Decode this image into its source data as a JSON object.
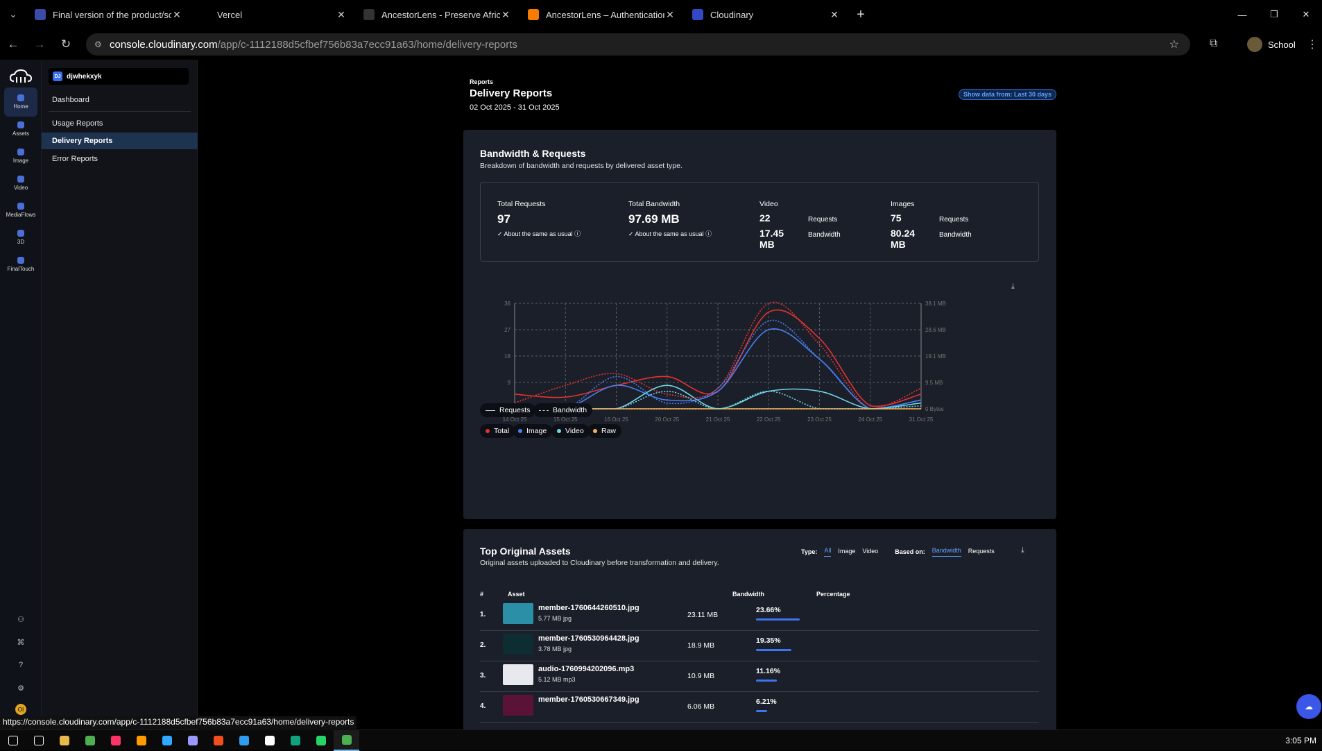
{
  "browser": {
    "tabs": [
      {
        "label": "Final version of the product/sol",
        "icon": "doc-icon",
        "color": "#3b4ba8"
      },
      {
        "label": "Vercel",
        "icon": "vercel-icon",
        "color": "#000000"
      },
      {
        "label": "AncestorLens - Preserve African",
        "icon": "globe-icon",
        "color": "#333333"
      },
      {
        "label": "AncestorLens – Authentication",
        "icon": "firebase-icon",
        "color": "#f57c00"
      },
      {
        "label": "Cloudinary",
        "icon": "cloudinary-icon",
        "color": "#3448c5"
      }
    ],
    "url_host": "console.cloudinary.com",
    "url_path": "/app/c-1112188d5cfbef756b83a7ecc91a63/home/delivery-reports",
    "profile": "School",
    "status_url": "https://console.cloudinary.com/app/c-1112188d5cfbef756b83a7ecc91a63/home/delivery-reports"
  },
  "rail": {
    "items": [
      {
        "label": "Home",
        "icon": "home-icon",
        "active": true
      },
      {
        "label": "Assets",
        "icon": "assets-icon"
      },
      {
        "label": "Image",
        "icon": "image-icon"
      },
      {
        "label": "Video",
        "icon": "video-icon"
      },
      {
        "label": "MediaFlows",
        "icon": "mediaflows-icon"
      },
      {
        "label": "3D",
        "icon": "cube-icon"
      },
      {
        "label": "FinalTouch",
        "icon": "finaltouch-icon"
      }
    ],
    "avatar": "OI"
  },
  "side": {
    "cloud_badge": "DJ",
    "cloud_name": "djwhekxyk",
    "dashboard": "Dashboard",
    "links": [
      "Usage Reports",
      "Delivery Reports",
      "Error Reports"
    ]
  },
  "header": {
    "crumb": "Reports",
    "title": "Delivery Reports",
    "range": "02 Oct 2025 - 31 Oct 2025",
    "filter": "Show data from: Last 30 days"
  },
  "bandwidth": {
    "title": "Bandwidth & Requests",
    "subtitle": "Breakdown of bandwidth and requests by delivered asset type.",
    "total_requests_label": "Total Requests",
    "total_requests": "97",
    "total_requests_note": "About the same as usual",
    "total_bandwidth_label": "Total Bandwidth",
    "total_bandwidth": "97.69 MB",
    "total_bandwidth_note": "About the same as usual",
    "video_label": "Video",
    "video_requests": "22",
    "video_bandwidth": "17.45 MB",
    "images_label": "Images",
    "images_requests": "75",
    "images_bandwidth": "80.24 MB",
    "requests_word": "Requests",
    "bandwidth_word": "Bandwidth",
    "legend_style": [
      "Requests",
      "Bandwidth"
    ],
    "legend_series": [
      {
        "name": "Total",
        "color": "#e5322f"
      },
      {
        "name": "Image",
        "color": "#4a7ef0"
      },
      {
        "name": "Video",
        "color": "#6fd6e6"
      },
      {
        "name": "Raw",
        "color": "#f2b25a"
      }
    ]
  },
  "chart_data": {
    "type": "line",
    "x": [
      "14 Oct 25",
      "15 Oct 25",
      "16 Oct 25",
      "20 Oct 25",
      "21 Oct 25",
      "22 Oct 25",
      "23 Oct 25",
      "24 Oct 25",
      "31 Oct 25"
    ],
    "y_left_ticks": [
      "0",
      "9",
      "18",
      "27",
      "36"
    ],
    "y_right_ticks": [
      "0 Bytes",
      "9.5 MB",
      "19.1 MB",
      "28.6 MB",
      "38.1 MB"
    ],
    "ylim": [
      0,
      36
    ],
    "series": [
      {
        "name": "Total",
        "style": "Requests",
        "color": "#e5322f",
        "values": [
          5,
          4,
          8,
          11,
          6,
          33,
          24,
          1,
          5
        ]
      },
      {
        "name": "Image",
        "style": "Requests",
        "color": "#4a7ef0",
        "values": [
          0,
          0,
          8,
          3,
          6,
          27,
          17,
          0,
          3
        ]
      },
      {
        "name": "Video",
        "style": "Requests",
        "color": "#6fd6e6",
        "values": [
          0,
          0,
          0,
          8,
          0,
          6,
          6,
          0,
          2
        ]
      },
      {
        "name": "Raw",
        "style": "Requests",
        "color": "#f2b25a",
        "values": [
          0,
          0,
          0,
          0,
          0,
          0,
          0,
          0,
          0
        ]
      },
      {
        "name": "Total",
        "style": "Bandwidth",
        "color": "#e5322f",
        "values": [
          2,
          8,
          12,
          5,
          7,
          36,
          22,
          0,
          7
        ]
      },
      {
        "name": "Image",
        "style": "Bandwidth",
        "color": "#4a7ef0",
        "values": [
          0,
          0,
          11,
          2,
          7,
          30,
          17,
          0,
          3
        ]
      },
      {
        "name": "Video",
        "style": "Bandwidth",
        "color": "#6fd6e6",
        "values": [
          0,
          0,
          0,
          6,
          0,
          6,
          0,
          0,
          1
        ]
      },
      {
        "name": "Raw",
        "style": "Bandwidth",
        "color": "#f2b25a",
        "values": [
          0,
          0,
          0,
          0,
          0,
          0,
          0,
          0,
          0
        ]
      }
    ]
  },
  "assets": {
    "title": "Top Original Assets",
    "subtitle": "Original assets uploaded to Cloudinary before transformation and delivery.",
    "type_label": "Type:",
    "type_options": [
      "All",
      "Image",
      "Video"
    ],
    "based_label": "Based on:",
    "based_options": [
      "Bandwidth",
      "Requests"
    ],
    "columns": [
      "#",
      "Asset",
      "Bandwidth",
      "Percentage"
    ],
    "rows": [
      {
        "num": "1.",
        "name": "member-1760644260510.jpg",
        "meta": "5.77 MB jpg",
        "bandwidth": "23.11 MB",
        "pct": "23.66%",
        "pct_value": 23.66,
        "thumb": "#2b8fa8"
      },
      {
        "num": "2.",
        "name": "member-1760530964428.jpg",
        "meta": "3.78 MB jpg",
        "bandwidth": "18.9 MB",
        "pct": "19.35%",
        "pct_value": 19.35,
        "thumb": "#0d2d33"
      },
      {
        "num": "3.",
        "name": "audio-1760994202096.mp3",
        "meta": "5.12 MB mp3",
        "bandwidth": "10.9 MB",
        "pct": "11.16%",
        "pct_value": 11.16,
        "thumb": "#e8e9ee"
      },
      {
        "num": "4.",
        "name": "member-1760530667349.jpg",
        "meta": "",
        "bandwidth": "6.06 MB",
        "pct": "6.21%",
        "pct_value": 6.21,
        "thumb": "#5a1236"
      }
    ]
  },
  "taskbar": {
    "icons": [
      "start-icon",
      "search-icon",
      "file-explorer-icon",
      "chrome-icon",
      "indesign-icon",
      "illustrator-icon",
      "lightroom-icon",
      "premiere-icon",
      "figma-icon",
      "vscode-icon",
      "capcut-icon",
      "chatgpt-icon",
      "whatsapp-icon",
      "chrome-active-icon"
    ],
    "clock": "3:05 PM"
  }
}
